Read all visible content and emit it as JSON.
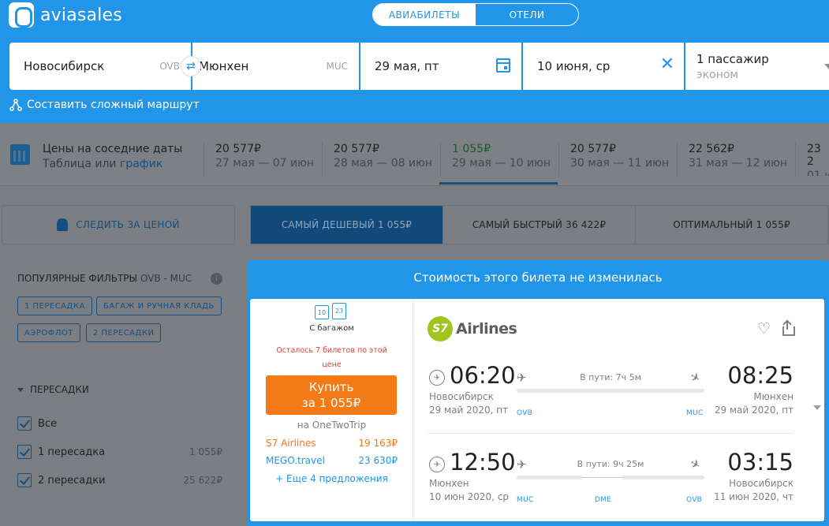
{
  "brand": {
    "name": "aviasales"
  },
  "header_tabs": [
    {
      "label": "АВИАБИЛЕТЫ",
      "active": true
    },
    {
      "label": "ОТЕЛИ",
      "active": false
    }
  ],
  "search": {
    "origin": {
      "city": "Новосибирск",
      "iata": "OVB"
    },
    "destination": {
      "city": "Мюнхен",
      "iata": "MUC"
    },
    "depart_date": "29 мая, пт",
    "return_date": "10 июня, ср",
    "passengers": "1 пассажир",
    "cabin": "эконом",
    "complex_route": "Составить сложный маршрут"
  },
  "nearby_dates": {
    "title": "Цены на соседние даты",
    "subtitle_prefix": "Таблица или",
    "subtitle_link": "график",
    "cells": [
      {
        "price": "20 577₽",
        "range": "27 мая — 07 июн"
      },
      {
        "price": "20 577₽",
        "range": "28 мая — 08 июн"
      },
      {
        "price": "1 055₽",
        "range": "29 мая — 10 июн"
      },
      {
        "price": "20 577₽",
        "range": "30 мая — 11 июн"
      },
      {
        "price": "22 562₽",
        "range": "31 мая — 12 июн"
      },
      {
        "price": "23 2",
        "range": "01 ию"
      }
    ],
    "selected_index": 2
  },
  "track_price": "СЛЕДИТЬ ЗА ЦЕНОЙ",
  "sort_tabs": [
    {
      "label": "САМЫЙ ДЕШЕВЫЙ",
      "price": "1 055₽",
      "active": true
    },
    {
      "label": "САМЫЙ БЫСТРЫЙ",
      "price": "36 422₽",
      "active": false
    },
    {
      "label": "ОПТИМАЛЬНЫЙ",
      "price": "1 055₽",
      "active": false
    }
  ],
  "popular_filters": {
    "title": "ПОПУЛЯРНЫЕ ФИЛЬТРЫ",
    "route": "OVB - MUC",
    "chips": [
      "1 ПЕРЕСАДКА",
      "БАГАЖ И РУЧНАЯ КЛАДЬ",
      "АЭРОФЛОТ",
      "2 ПЕРЕСАДКИ"
    ]
  },
  "stops_filter": {
    "title": "ПЕРЕСАДКИ",
    "options": [
      {
        "label": "Все",
        "amount": "",
        "checked": true
      },
      {
        "label": "1 пересадка",
        "amount": "1 055₽",
        "checked": true
      },
      {
        "label": "2 пересадки",
        "amount": "25 622₽",
        "checked": true
      }
    ]
  },
  "ticket": {
    "notice": "Стоимость этого билета не изменилась",
    "baggage_label": "С багажом",
    "baggage_kg": [
      "10",
      "23"
    ],
    "left_note": "Осталось 7 билетов по этой цене",
    "buy_line1": "Купить",
    "buy_line2": "за 1 055₽",
    "on_site": "на OneTwoTrip",
    "offers": [
      {
        "name": "S7 Airlines",
        "price": "19 163₽"
      },
      {
        "name": "MEGO.travel",
        "price": "23 630₽"
      }
    ],
    "more_offers": "+ Еще 4 предложения",
    "airline": "Airlines",
    "airline_mark": "S7",
    "segments": [
      {
        "dep_time": "06:20",
        "arr_time": "08:25",
        "dep_city": "Новосибирск",
        "arr_city": "Мюнхен",
        "dep_date": "29 май 2020, пт",
        "arr_date": "29 май 2020, пт",
        "duration": "В пути: 7ч 5м",
        "codes": [
          "OVB",
          "MUC"
        ]
      },
      {
        "dep_time": "12:50",
        "arr_time": "03:15",
        "dep_city": "Мюнхен",
        "arr_city": "Новосибирск",
        "dep_date": "10 июн 2020, ср",
        "arr_date": "11 июн 2020, чт",
        "duration": "В пути: 9ч 25м",
        "codes": [
          "MUC",
          "DME",
          "OVB"
        ]
      }
    ]
  },
  "colors": {
    "primary": "#2196e8",
    "buy": "#f37a16",
    "warning": "#e3402f",
    "s7": "#a2c421"
  }
}
